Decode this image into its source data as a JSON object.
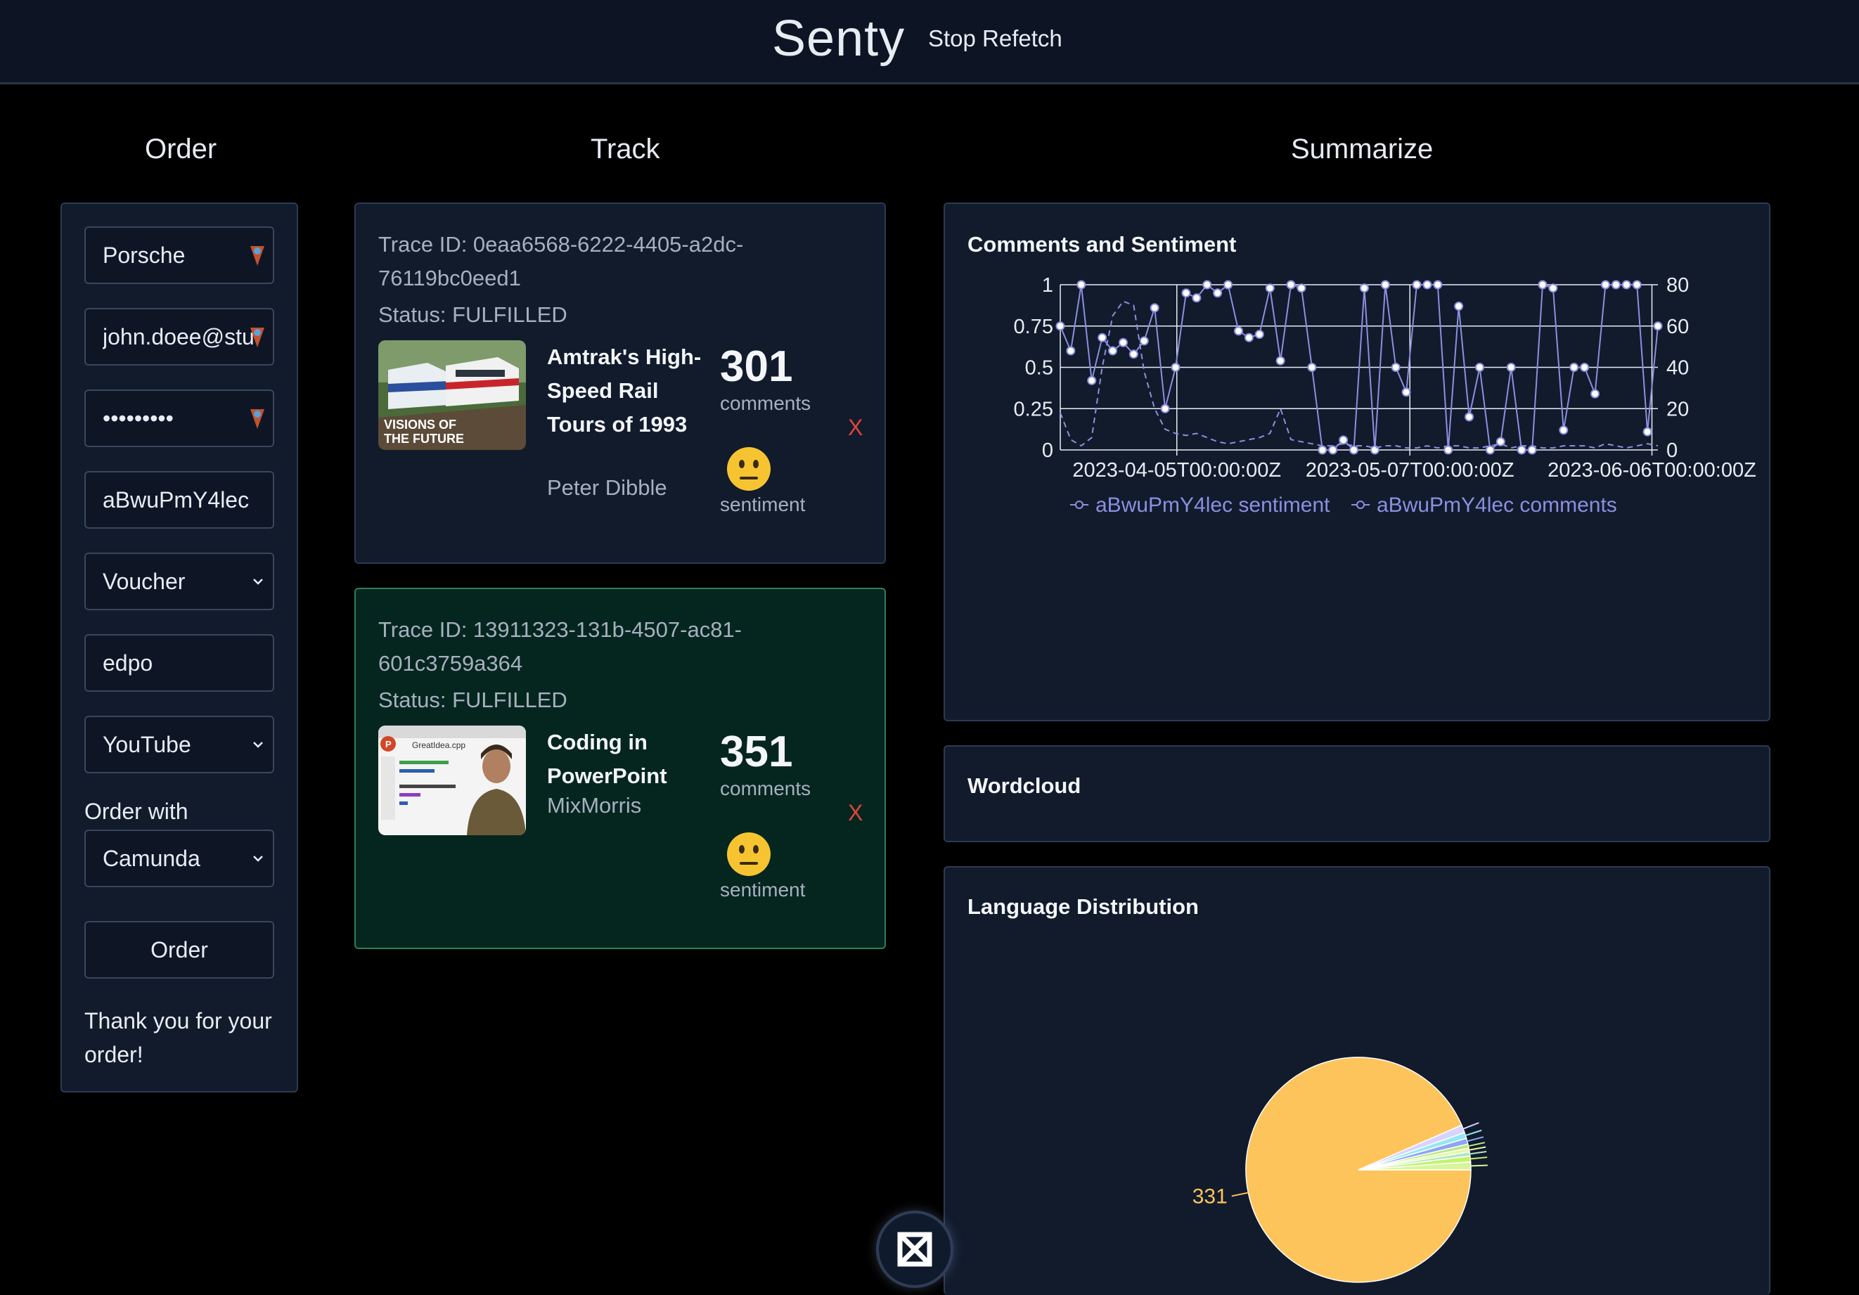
{
  "header": {
    "brand": "Senty",
    "stop_refetch": "Stop Refetch"
  },
  "columns": {
    "order": "Order",
    "track": "Track",
    "summarize": "Summarize"
  },
  "order_form": {
    "brand_field": "Porsche",
    "email_field": "john.doee@stu",
    "password_field": "•••••••••",
    "video_id_field": "aBwuPmY4lec",
    "voucher_select": "Voucher",
    "code_field": "edpo",
    "platform_select": "YouTube",
    "order_with_label": "Order with",
    "engine_select": "Camunda",
    "order_button": "Order",
    "thanks_message": "Thank you for your order!"
  },
  "track": {
    "cards": [
      {
        "trace": "Trace ID: 0eaa6568-6222-4405-a2dc-76119bc0eed1",
        "status": "Status: FULFILLED",
        "title": "Amtrak's High-Speed Rail Tours of 1993",
        "author": "Peter Dibble",
        "thumb_caption_1": "VISIONS OF",
        "thumb_caption_2": "THE FUTURE",
        "count": "301",
        "count_label": "comments",
        "sentiment_label": "sentiment",
        "close": "X",
        "background": "#111b2c",
        "border": "#2c3a52"
      },
      {
        "trace": "Trace ID: 13911323-131b-4507-ac81-601c3759a364",
        "status": "Status: FULFILLED",
        "title": "Coding in PowerPoint",
        "author": "MixMorris",
        "thumb_caption_1": "GreatIdea.cpp",
        "count": "351",
        "count_label": "comments",
        "sentiment_label": "sentiment",
        "close": "X",
        "background": "#04261f",
        "border": "#2f7d5a"
      }
    ]
  },
  "summarize": {
    "comments_panel_title": "Comments and Sentiment",
    "wordcloud_title": "Wordcloud",
    "language_title": "Language Distribution",
    "pie_label": "331"
  },
  "chart_data": [
    {
      "type": "line",
      "title": "Comments and Sentiment",
      "x_tick_labels": [
        "2023-04-05T00:00:00Z",
        "2023-05-07T00:00:00Z",
        "2023-06-06T00:00:00Z"
      ],
      "y_left_ticks": [
        "0",
        "0.25",
        "0.5",
        "0.75",
        "1"
      ],
      "y_right_ticks": [
        "0",
        "20",
        "40",
        "60",
        "80"
      ],
      "ylim_left": [
        0,
        1
      ],
      "ylim_right": [
        0,
        80
      ],
      "grid": true,
      "legend_position": "bottom",
      "series": [
        {
          "name": "aBwuPmY4lec sentiment",
          "axis": "left",
          "style": "solid",
          "color": "#8c8fe0",
          "values": [
            0.75,
            0.6,
            1,
            0.42,
            0.68,
            0.6,
            0.65,
            0.58,
            0.66,
            0.86,
            0.25,
            0.5,
            0.95,
            0.92,
            1,
            0.95,
            1,
            0.72,
            0.68,
            0.7,
            0.98,
            0.54,
            1,
            0.98,
            0.5,
            0,
            0,
            0.06,
            0,
            0.98,
            0,
            1,
            0.5,
            0.35,
            1,
            1,
            1,
            0,
            0.87,
            0.2,
            0.5,
            0,
            0.05,
            0.5,
            0,
            0,
            1,
            0.98,
            0.12,
            0.5,
            0.5,
            0.34,
            1,
            1,
            1,
            1,
            0.11,
            0.75
          ]
        },
        {
          "name": "aBwuPmY4lec comments",
          "axis": "right",
          "style": "dashed",
          "color": "#8c8fe0",
          "values": [
            18,
            5,
            2,
            6,
            40,
            65,
            72,
            70,
            38,
            20,
            10,
            8,
            7,
            8,
            6,
            4,
            3,
            4,
            5,
            6,
            8,
            20,
            5,
            4,
            3,
            2,
            2,
            3,
            2,
            2,
            1,
            2,
            2,
            1,
            1,
            2,
            1,
            2,
            2,
            1,
            1,
            2,
            3,
            1,
            2,
            2,
            1,
            1,
            2,
            2,
            2,
            1,
            3,
            2,
            1,
            2,
            3,
            2
          ]
        }
      ]
    },
    {
      "type": "pie",
      "title": "Language Distribution",
      "labels": [
        "331",
        "",
        "",
        "",
        "",
        "",
        "",
        "",
        ""
      ],
      "values": [
        331,
        4,
        3,
        3,
        2,
        2,
        2,
        3,
        4
      ],
      "colors": [
        "#fec45c",
        "#d8d3ff",
        "#96e6f5",
        "#8aa7f0",
        "#b7e97f",
        "#e6f7a0",
        "#a9e8c2",
        "#c6f26e",
        "#d7f59a"
      ]
    }
  ]
}
